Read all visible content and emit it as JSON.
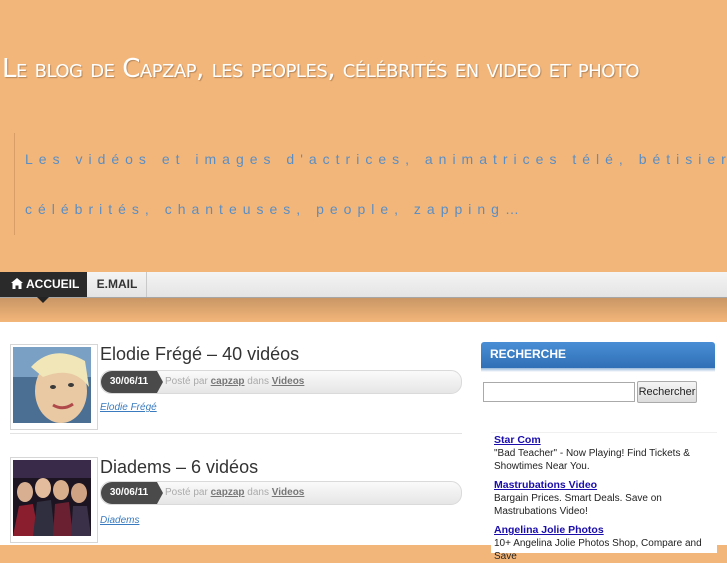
{
  "site": {
    "title": "Le blog de Capzap, les peoples, célébrités en video et photo",
    "tagline_line1": "Les vidéos et images d'actrices, animatrices télé, bétisier,",
    "tagline_line2": "célébrités, chanteuses, people, zapping…"
  },
  "nav": {
    "home_label": "Accueil",
    "email_label": "E.mail"
  },
  "posts": [
    {
      "title": "Elodie Frégé – 40 vidéos",
      "date": "30/06/11",
      "posted_by_prefix": "Posté par",
      "author": "capzap",
      "in_prefix": "dans",
      "category": "Videos",
      "tag": "Elodie Frégé"
    },
    {
      "title": "Diadems – 6 vidéos",
      "date": "30/06/11",
      "posted_by_prefix": "Posté par",
      "author": "capzap",
      "in_prefix": "dans",
      "category": "Videos",
      "tag": "Diadems"
    }
  ],
  "sidebar": {
    "search_heading": "Recherche",
    "search_value": "",
    "search_button": "Rechercher",
    "ads": [
      {
        "title": "Star Com",
        "text": "\"Bad Teacher\" - Now Playing! Find Tickets & Showtimes Near You."
      },
      {
        "title": "Mastrubations Video",
        "text": "Bargain Prices. Smart Deals. Save on Mastrubations Video!"
      },
      {
        "title": "Angelina Jolie Photos",
        "text": "10+ Angelina Jolie Photos Shop, Compare and Save"
      }
    ]
  },
  "colors": {
    "header_bg": "#f3b67a",
    "title_text": "#ffffff",
    "tagline_text": "#5a8ec4",
    "nav_active_bg": "#2a2a2a",
    "sidebar_heading_bg": "#2f6fb5",
    "link": "#3a7bbf"
  }
}
